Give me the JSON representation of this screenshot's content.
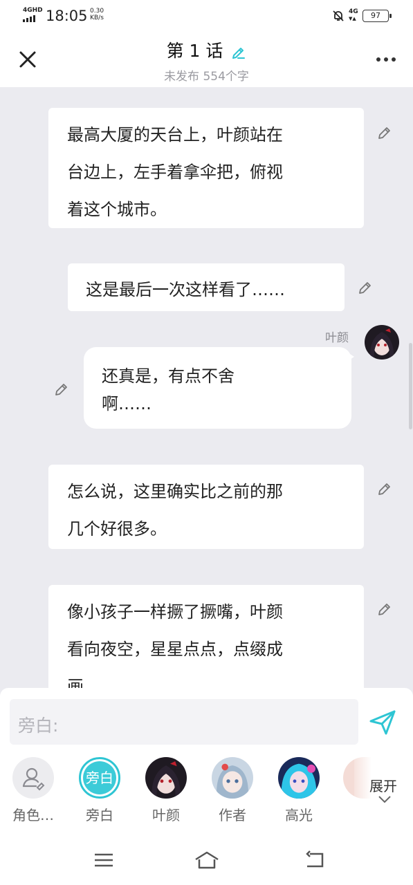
{
  "status_bar": {
    "network": "4GHD",
    "time": "18:05",
    "speed_value": "0.30",
    "speed_unit": "KB/s",
    "signal_right": "4G",
    "battery": "97"
  },
  "header": {
    "title": "第 1 话",
    "subtitle": "未发布 554个字",
    "accent": "#2ec5d3"
  },
  "messages": [
    {
      "type": "narration",
      "lines": [
        "最高大厦的天台上，叶颜站在",
        "台边上，左手着拿伞把，俯视",
        "着这个城市。"
      ]
    },
    {
      "type": "narration",
      "lines": [
        "这是最后一次这样看了……"
      ]
    },
    {
      "type": "character",
      "speaker": "叶颜",
      "lines": [
        "还真是，有点不舍",
        "啊……"
      ]
    },
    {
      "type": "narration",
      "lines": [
        "怎么说，这里确实比之前的那",
        "几个好很多。"
      ]
    },
    {
      "type": "narration",
      "lines": [
        "像小孩子一样撅了撅嘴，叶颜",
        "看向夜空，星星点点，点缀成",
        "画。"
      ]
    }
  ],
  "input": {
    "placeholder": "旁白:"
  },
  "roles": [
    {
      "label": "角色…",
      "icon": "person-edit-icon"
    },
    {
      "label": "旁白",
      "avatar_text": "旁白"
    },
    {
      "label": "叶颜",
      "icon": "avatar-yeyan"
    },
    {
      "label": "作者",
      "icon": "avatar-author"
    },
    {
      "label": "高光",
      "icon": "avatar-gaoguang"
    }
  ],
  "expand_label": "展开",
  "colors": {
    "background": "#ebebf0",
    "accent": "#2ec5d3",
    "bubble": "#ffffff"
  }
}
